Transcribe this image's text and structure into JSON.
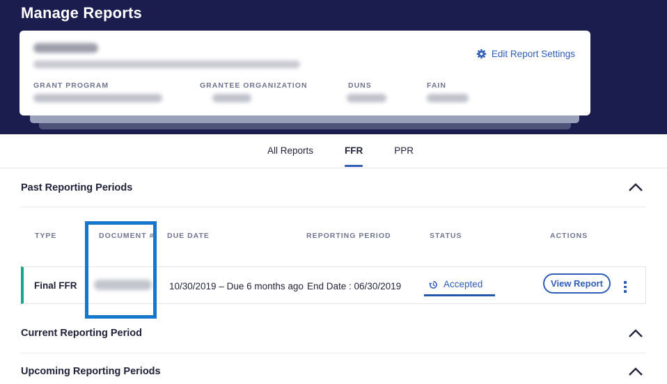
{
  "page": {
    "title": "Manage Reports"
  },
  "grant_card": {
    "edit_settings_label": "Edit Report Settings",
    "field_labels": [
      "GRANT PROGRAM",
      "GRANTEE ORGANIZATION",
      "DUNS",
      "FAIN"
    ]
  },
  "tabs": [
    {
      "label": "All Reports",
      "active": false
    },
    {
      "label": "FFR",
      "active": true
    },
    {
      "label": "PPR",
      "active": false
    }
  ],
  "sections": {
    "past": {
      "title": "Past Reporting Periods"
    },
    "current": {
      "title": "Current Reporting Period"
    },
    "upcoming": {
      "title": "Upcoming Reporting Periods"
    }
  },
  "table": {
    "headers": [
      "TYPE",
      "DOCUMENT #",
      "DUE DATE",
      "REPORTING PERIOD",
      "STATUS",
      "ACTIONS"
    ],
    "row": {
      "type": "Final FFR",
      "due_date": "10/30/2019 – Due 6 months ago",
      "reporting_period": "End Date : 06/30/2019",
      "status": "Accepted",
      "view_report_label": "View Report"
    }
  },
  "colors": {
    "header_navy": "#1c1d4f",
    "accent_blue": "#2e5cb8",
    "highlight_blue": "#1477cc",
    "row_accent_teal": "#15a78c"
  }
}
